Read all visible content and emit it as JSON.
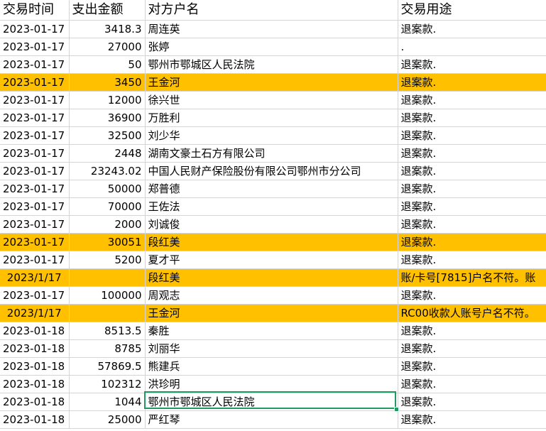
{
  "headers": [
    "交易时间",
    "支出金额",
    "对方户名",
    "交易用途"
  ],
  "rows": [
    {
      "time": "2023-01-17",
      "amount": "3418.3",
      "name": "周连英",
      "purpose": "退案款.",
      "hl": false
    },
    {
      "time": "2023-01-17",
      "amount": "27000",
      "name": "张婷",
      "purpose": ".",
      "hl": false
    },
    {
      "time": "2023-01-17",
      "amount": "50",
      "name": "鄂州市鄂城区人民法院",
      "purpose": "退案款.",
      "hl": false
    },
    {
      "time": "2023-01-17",
      "amount": "3450",
      "name": "王金河",
      "purpose": "退案款.",
      "hl": true
    },
    {
      "time": "2023-01-17",
      "amount": "12000",
      "name": "徐兴世",
      "purpose": "退案款.",
      "hl": false
    },
    {
      "time": "2023-01-17",
      "amount": "36900",
      "name": "万胜利",
      "purpose": "退案款.",
      "hl": false
    },
    {
      "time": "2023-01-17",
      "amount": "32500",
      "name": "刘少华",
      "purpose": "退案款.",
      "hl": false
    },
    {
      "time": "2023-01-17",
      "amount": "2448",
      "name": "湖南文豪土石方有限公司",
      "purpose": "退案款.",
      "hl": false
    },
    {
      "time": "2023-01-17",
      "amount": "23243.02",
      "name": "中国人民财产保险股份有限公司鄂州市分公司",
      "purpose": "退案款.",
      "hl": false
    },
    {
      "time": "2023-01-17",
      "amount": "50000",
      "name": "郑普德",
      "purpose": "退案款.",
      "hl": false
    },
    {
      "time": "2023-01-17",
      "amount": "70000",
      "name": "王佐法",
      "purpose": "退案款.",
      "hl": false
    },
    {
      "time": "2023-01-17",
      "amount": "2000",
      "name": "刘诚俊",
      "purpose": "退案款.",
      "hl": false
    },
    {
      "time": "2023-01-17",
      "amount": "30051",
      "name": "段红美",
      "purpose": "退案款.",
      "hl": true
    },
    {
      "time": "2023-01-17",
      "amount": "5200",
      "name": "夏才平",
      "purpose": "退案款.",
      "hl": false
    },
    {
      "time": "2023/1/17",
      "amount": "",
      "name": "段红美",
      "purpose": "账/卡号[7815]户名不符。账",
      "hl": true,
      "center": true
    },
    {
      "time": "2023-01-17",
      "amount": "100000",
      "name": "周观志",
      "purpose": "退案款.",
      "hl": false
    },
    {
      "time": "2023/1/17",
      "amount": "",
      "name": "王金河",
      "purpose": "RC00收款人账号户名不符。",
      "hl": true,
      "center": true
    },
    {
      "time": "2023-01-18",
      "amount": "8513.5",
      "name": "秦胜",
      "purpose": "退案款.",
      "hl": false
    },
    {
      "time": "2023-01-18",
      "amount": "8785",
      "name": "刘丽华",
      "purpose": "退案款.",
      "hl": false
    },
    {
      "time": "2023-01-18",
      "amount": "57869.5",
      "name": "熊建兵",
      "purpose": "退案款.",
      "hl": false
    },
    {
      "time": "2023-01-18",
      "amount": "102312",
      "name": "洪珍明",
      "purpose": "退案款.",
      "hl": false
    },
    {
      "time": "2023-01-18",
      "amount": "1044",
      "name": "鄂州市鄂城区人民法院",
      "purpose": "退案款.",
      "hl": false
    },
    {
      "time": "2023-01-18",
      "amount": "25000",
      "name": "严红琴",
      "purpose": "退案款.",
      "hl": false
    }
  ]
}
